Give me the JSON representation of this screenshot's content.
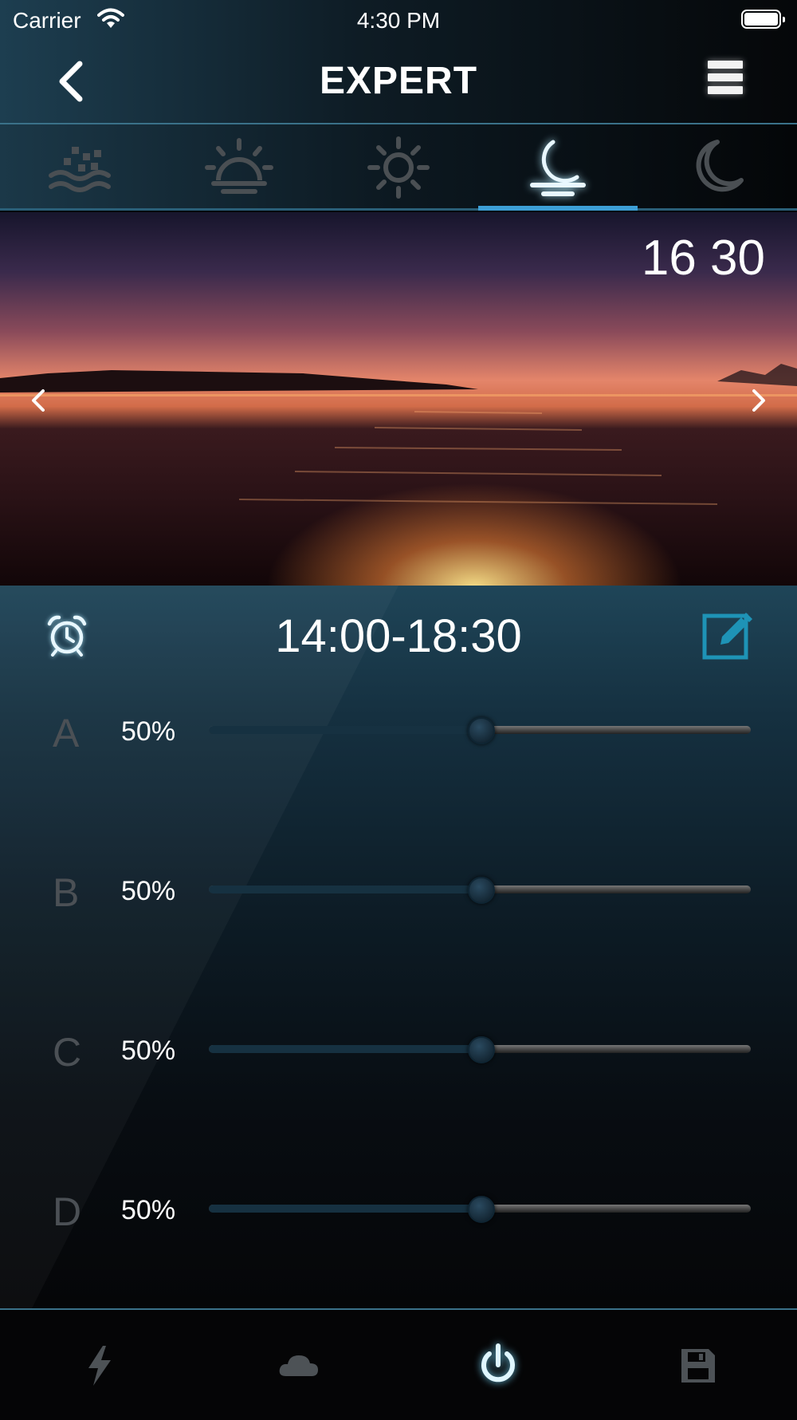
{
  "status_bar": {
    "carrier": "Carrier",
    "time": "4:30 PM"
  },
  "header": {
    "title": "EXPERT"
  },
  "modes": [
    {
      "icon": "water-waves-icon",
      "active": false
    },
    {
      "icon": "sunrise-icon",
      "active": false
    },
    {
      "icon": "sun-icon",
      "active": false
    },
    {
      "icon": "moon-set-icon",
      "active": true
    },
    {
      "icon": "moon-icon",
      "active": false
    }
  ],
  "hero": {
    "time": "16 30"
  },
  "schedule": {
    "time_range": "14:00-18:30",
    "channels": [
      {
        "letter": "A",
        "percent_label": "50%",
        "value": 0.5
      },
      {
        "letter": "B",
        "percent_label": "50%",
        "value": 0.5
      },
      {
        "letter": "C",
        "percent_label": "50%",
        "value": 0.5
      },
      {
        "letter": "D",
        "percent_label": "50%",
        "value": 0.5
      }
    ]
  },
  "bottom_tabs": [
    {
      "icon": "lightning-icon",
      "active": false
    },
    {
      "icon": "cloud-icon",
      "active": false
    },
    {
      "icon": "power-icon",
      "active": true
    },
    {
      "icon": "save-icon",
      "active": false
    }
  ],
  "colors": {
    "accent": "#3d9fd6",
    "active_icon": "#e8f7ff",
    "inactive_icon": "#555a5e"
  }
}
